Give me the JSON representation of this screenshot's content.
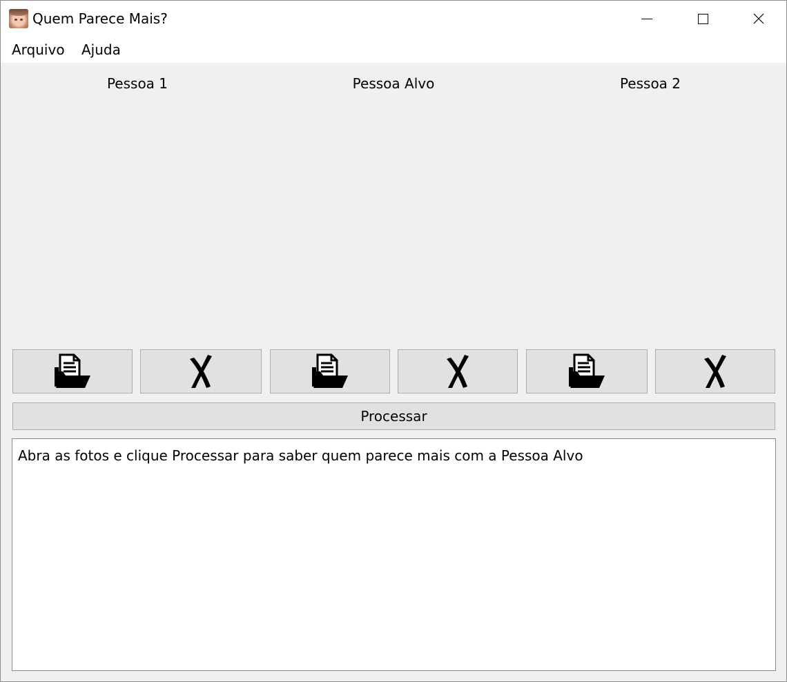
{
  "window": {
    "title": "Quem Parece Mais?",
    "icon": "baby-face-icon"
  },
  "title_controls": {
    "minimize_icon": "minimize-icon",
    "maximize_icon": "maximize-icon",
    "close_icon": "close-icon"
  },
  "menubar": {
    "items": [
      {
        "label": "Arquivo"
      },
      {
        "label": "Ajuda"
      }
    ]
  },
  "columns": [
    {
      "label": "Pessoa 1"
    },
    {
      "label": "Pessoa Alvo"
    },
    {
      "label": "Pessoa 2"
    }
  ],
  "buttons": {
    "open_icon": "open-folder-icon",
    "clear_icon": "x-mark-icon",
    "process_label": "Processar"
  },
  "output": {
    "text": "Abra as fotos e clique Processar para saber quem parece mais com a Pessoa Alvo"
  },
  "colors": {
    "window_bg": "#f0f0f0",
    "button_bg": "#e1e1e1",
    "button_border": "#adadad"
  }
}
